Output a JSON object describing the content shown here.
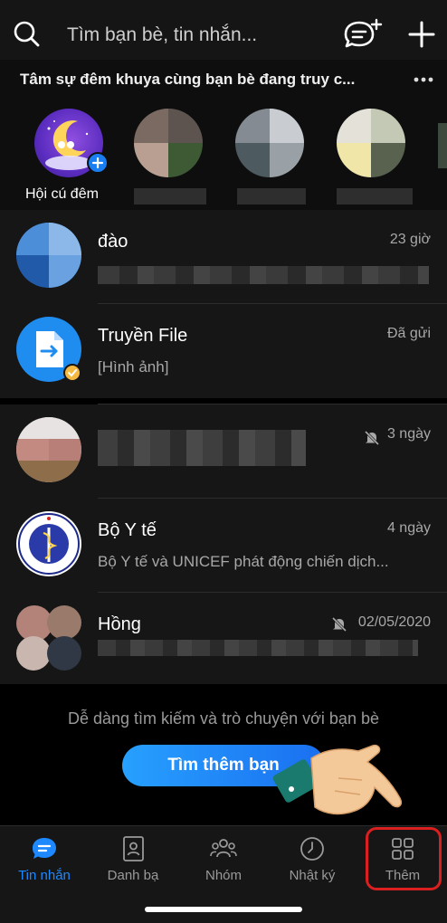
{
  "header": {
    "search_placeholder": "Tìm bạn bè, tin nhắn...",
    "icons": [
      "search-icon",
      "new-message-icon",
      "plus-icon"
    ]
  },
  "stories": {
    "title": "Tâm sự đêm khuya cùng bạn bè đang truy c...",
    "first_label": "Hội cú đêm"
  },
  "chats": [
    {
      "name": "đào",
      "preview": "",
      "time": "23 giờ",
      "muted": false
    },
    {
      "name": "Truyền File",
      "preview": "[Hình ảnh]",
      "time": "Đã gửi",
      "muted": false
    },
    {
      "name": "",
      "preview": "",
      "time": "3 ngày",
      "muted": true
    },
    {
      "name": "Bộ Y tế",
      "preview": "Bộ Y tế và UNICEF phát động chiến dịch...",
      "time": "4 ngày",
      "muted": false
    },
    {
      "name": "Hồng",
      "preview": "",
      "time": "02/05/2020",
      "muted": true
    }
  ],
  "find_friends": {
    "message": "Dễ dàng tìm kiếm và trò chuyện với bạn bè",
    "button_label": "Tìm thêm bạn"
  },
  "bottom_nav": [
    {
      "label": "Tin nhắn",
      "icon": "chat-bubble-icon",
      "active": true
    },
    {
      "label": "Danh bạ",
      "icon": "contacts-icon",
      "active": false
    },
    {
      "label": "Nhóm",
      "icon": "group-icon",
      "active": false
    },
    {
      "label": "Nhật ký",
      "icon": "clock-icon",
      "active": false
    },
    {
      "label": "Thêm",
      "icon": "grid-icon",
      "active": false
    }
  ],
  "colors": {
    "accent": "#1e88ff",
    "highlight": "#d91f1f",
    "background": "#000000"
  }
}
